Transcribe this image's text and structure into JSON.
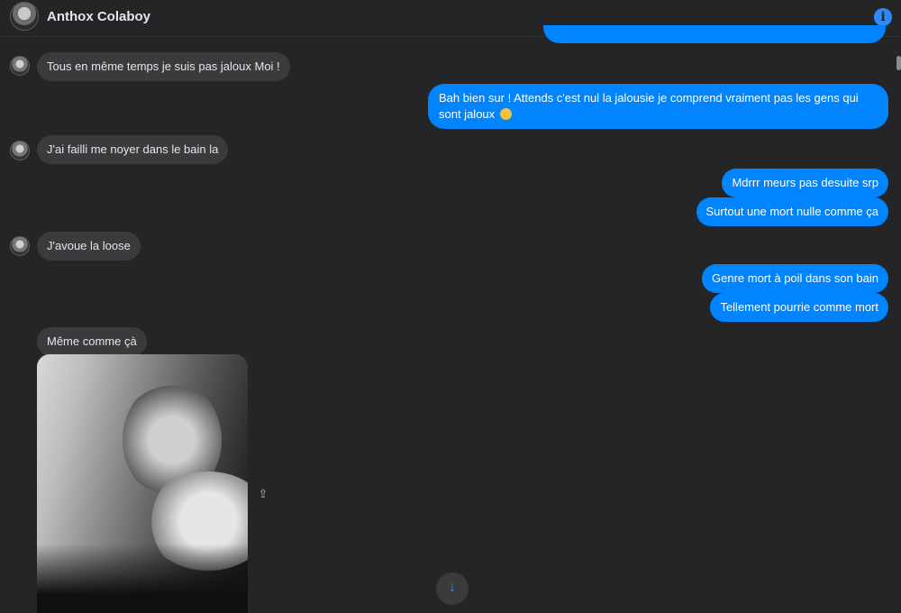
{
  "header": {
    "contact_name": "Anthox Colaboy",
    "avatar_icon": "contact-avatar",
    "info_icon": "info-icon",
    "info_glyph": "i"
  },
  "messages": [
    {
      "side": "in",
      "text": "Tous en même temps je suis pas jaloux Moi !"
    },
    {
      "side": "out",
      "text": "Bah bien sur ! Attends c'est nul la jalousie je comprend vraiment pas les gens qui sont jaloux",
      "emoji": "thinking-face-emoji"
    },
    {
      "side": "in",
      "text": "J'ai failli me noyer dans le bain la"
    },
    {
      "side": "out",
      "text": "Mdrrr meurs pas desuite srp"
    },
    {
      "side": "out",
      "text": "Surtout une mort nulle comme ça"
    },
    {
      "side": "in",
      "text": "J'avoue la loose"
    },
    {
      "side": "out",
      "text": "Genre mort à poil dans son bain"
    },
    {
      "side": "out",
      "text": "Tellement pourrie comme mort"
    },
    {
      "side": "in",
      "text": "Même comme çà"
    }
  ],
  "attachment": {
    "type": "photo",
    "share_icon": "share-icon",
    "share_glyph": "⇪"
  },
  "scroll_down": {
    "icon": "arrow-down-icon",
    "glyph": "↓"
  },
  "colors": {
    "background": "#242526",
    "incoming_bubble": "#3a3b3c",
    "outgoing_bubble": "#0084ff",
    "accent": "#2e89ff"
  }
}
